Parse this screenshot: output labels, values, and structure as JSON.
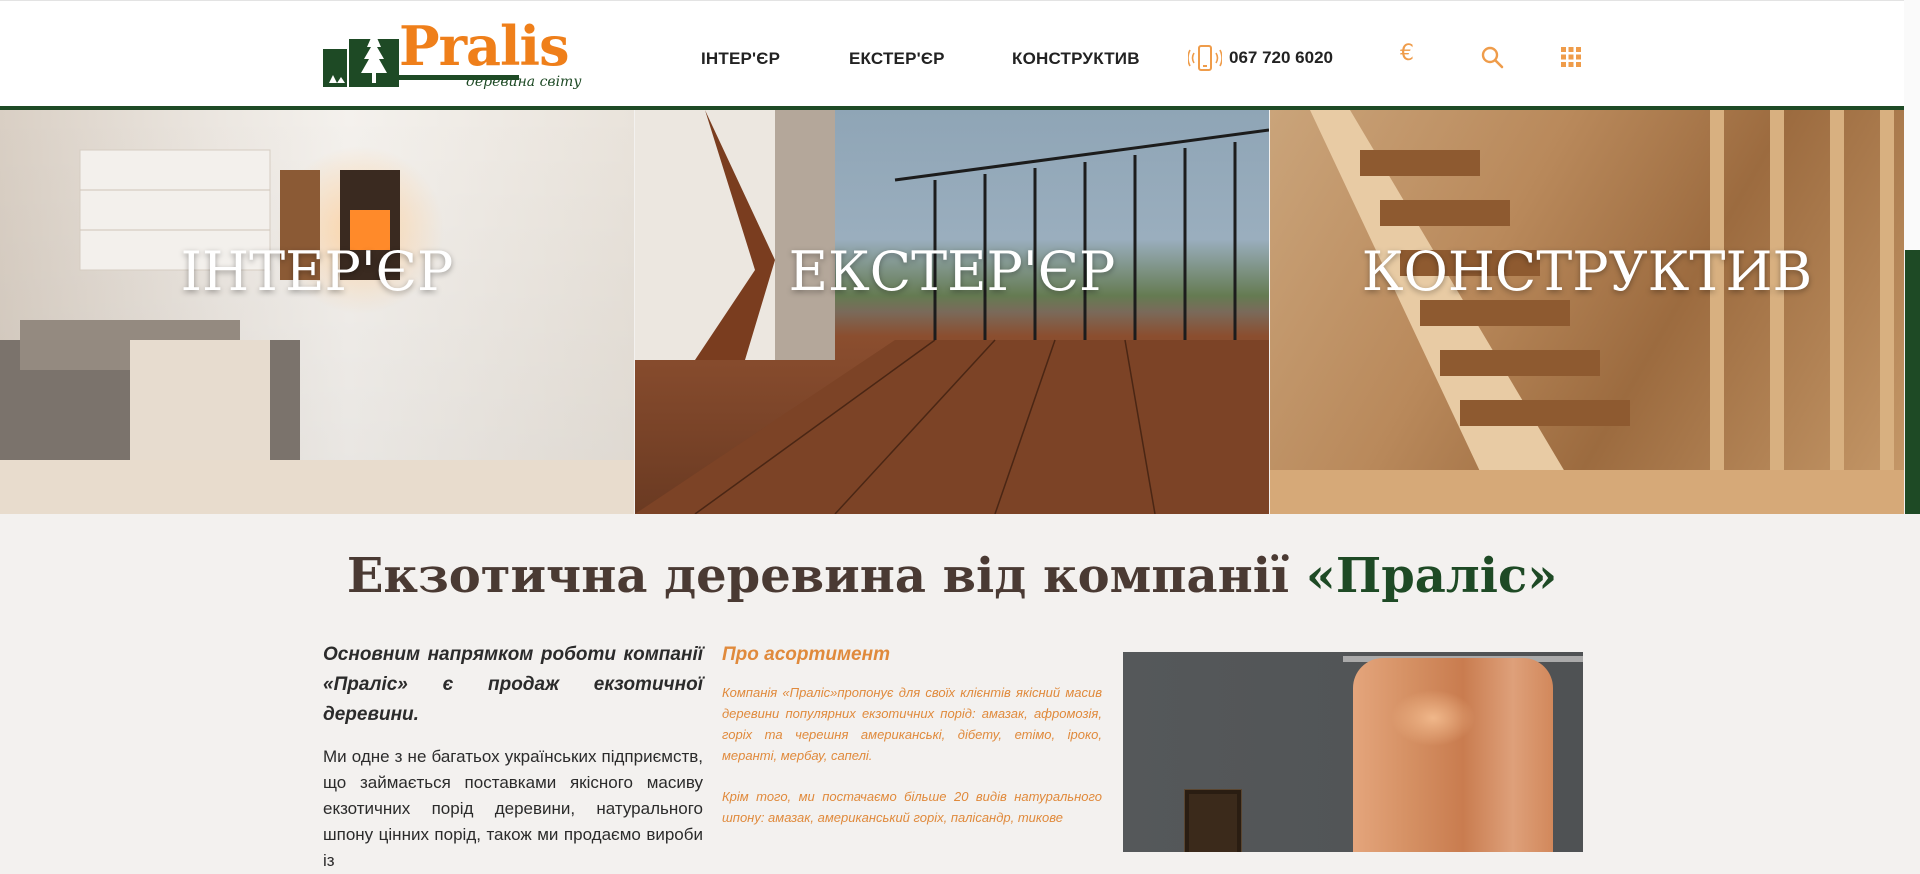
{
  "header": {
    "logo": {
      "name": "Pralis",
      "tagline": "деревина світу"
    },
    "nav": [
      {
        "label": "ІНТЕР'ЄР"
      },
      {
        "label": "ЕКСТЕР'ЄР"
      },
      {
        "label": "КОНСТРУКТИВ"
      }
    ],
    "phone": "067 720 6020",
    "icons": {
      "phone": "phone-icon",
      "euro": "euro-icon",
      "search": "search-icon",
      "menu": "grid-icon"
    },
    "euro_symbol": "€"
  },
  "hero": [
    {
      "label": "ІНТЕР'ЄР"
    },
    {
      "label": "ЕКСТЕР'ЄР"
    },
    {
      "label": "КОНСТРУКТИВ"
    }
  ],
  "main": {
    "headline_main": "Екзотична деревина від компанії",
    "headline_accent": "«Праліс»",
    "col1_lead": "Основним напрямком роботи компанії «Праліс» є продаж екзотичної деревини.",
    "col1_body": "Ми одне з не багатьох українських підприємств, що займається поставками якісного масиву екзотичних порід деревини, натурального шпону цінних порід, також ми продаємо вироби із",
    "col2_title": "Про асортимент",
    "col2_p1": "Компанія «Праліс»пропонує для своїх клієнтів якісний масив деревини популярних екзотичних порід: амазак, афромозія, горіх та черешня американські, дібету, етімо, іроко, меранті, мербау, сапелі.",
    "col2_p2": "Крім того, ми постачаємо більше 20 видів натурального шпону: амазак, американський горіх, палісандр, тикове"
  },
  "colors": {
    "accent_orange": "#ef7f1a",
    "brand_green": "#1e4a25",
    "headline_brown": "#4a3a33"
  }
}
